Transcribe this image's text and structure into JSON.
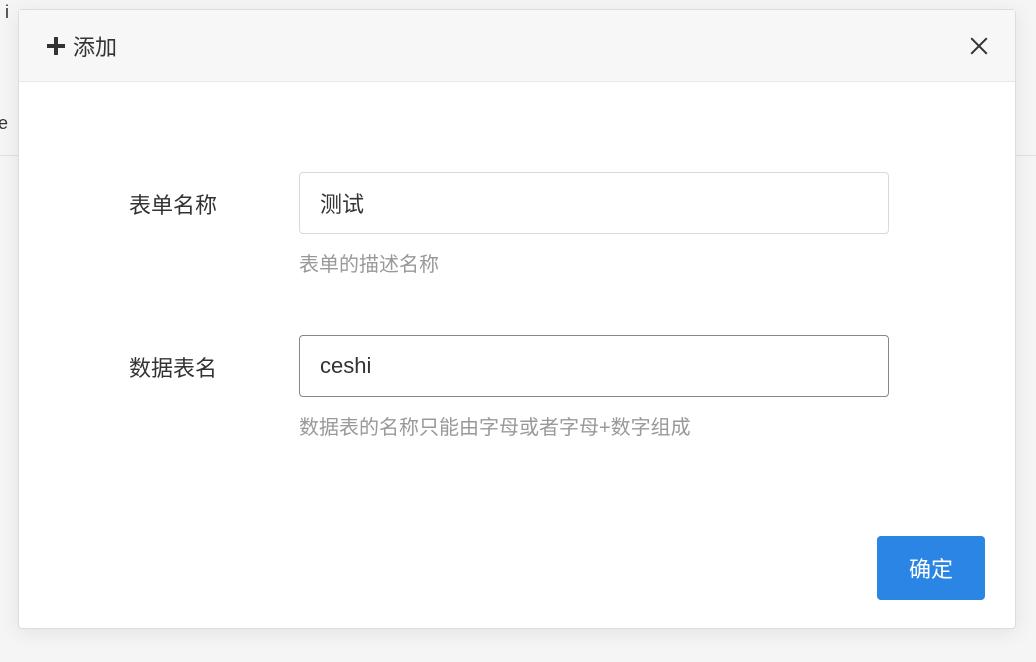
{
  "background": {
    "text1": "i",
    "text2": "e"
  },
  "modal": {
    "title": "添加",
    "form": {
      "name": {
        "label": "表单名称",
        "value": "测试",
        "help": "表单的描述名称"
      },
      "table": {
        "label": "数据表名",
        "value": "ceshi",
        "help": "数据表的名称只能由字母或者字母+数字组成"
      }
    },
    "confirm": "确定"
  }
}
